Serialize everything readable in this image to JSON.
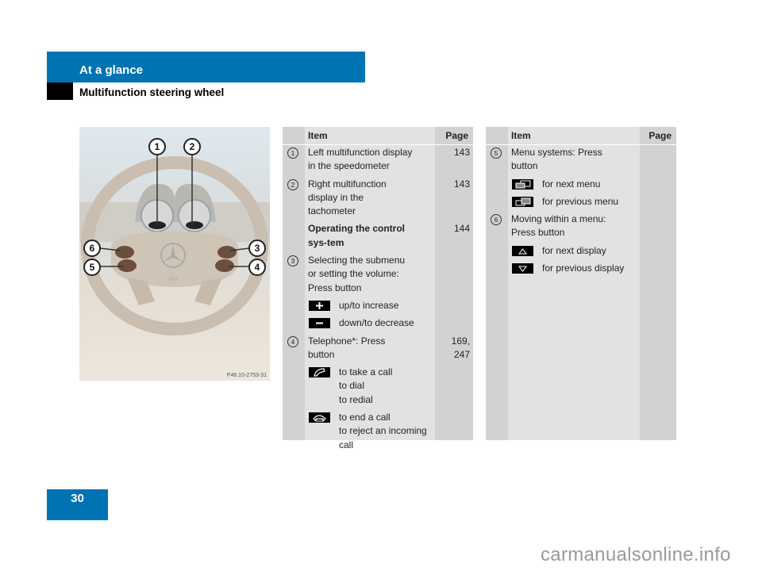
{
  "header": {
    "section": "At a glance",
    "subtitle": "Multifunction steering wheel"
  },
  "page_number": "30",
  "figure": {
    "code": "P46.10-2753-31",
    "callouts": [
      "1",
      "2",
      "3",
      "4",
      "5",
      "6"
    ],
    "emblem_text": "SRS"
  },
  "colors": {
    "brand_blue": "#0074b3",
    "table_side": "#d2d2d2",
    "table_item": "#e2e2e2"
  },
  "table_left": {
    "headers": {
      "item": "Item",
      "page": "Page"
    },
    "rows": [
      {
        "num": "1",
        "text": "Left multifunction display in the speedometer",
        "page": "143"
      },
      {
        "num": "2",
        "text": "Right multifunction display in the tachometer",
        "page": "143"
      },
      {
        "num": "",
        "text": "Operating the control sys-tem",
        "page": "144",
        "bold": true
      },
      {
        "num": "3",
        "text": "Selecting the submenu or setting the volume: Press button",
        "page": ""
      },
      {
        "icon": "plus-button-icon",
        "text": "up/to increase"
      },
      {
        "icon": "minus-button-icon",
        "text": "down/to decrease"
      },
      {
        "num": "4",
        "text": "Telephone*: Press button",
        "page": "169, 247"
      },
      {
        "icon": "phone-pickup-icon",
        "text": "to take a call to dial to redial"
      },
      {
        "icon": "phone-hangup-icon",
        "text": "to end a call to reject an incoming call"
      }
    ]
  },
  "table_right": {
    "headers": {
      "item": "Item",
      "page": "Page"
    },
    "rows": [
      {
        "num": "5",
        "text": "Menu systems: Press button",
        "page": ""
      },
      {
        "icon": "next-menu-icon",
        "text": "for next menu"
      },
      {
        "icon": "previous-menu-icon",
        "text": "for previous menu"
      },
      {
        "num": "6",
        "text": "Moving within a menu: Press button",
        "page": ""
      },
      {
        "icon": "arrow-up-icon",
        "text": "for next display"
      },
      {
        "icon": "arrow-down-icon",
        "text": "for previous display"
      }
    ]
  },
  "watermark": "carmanualsonline.info"
}
